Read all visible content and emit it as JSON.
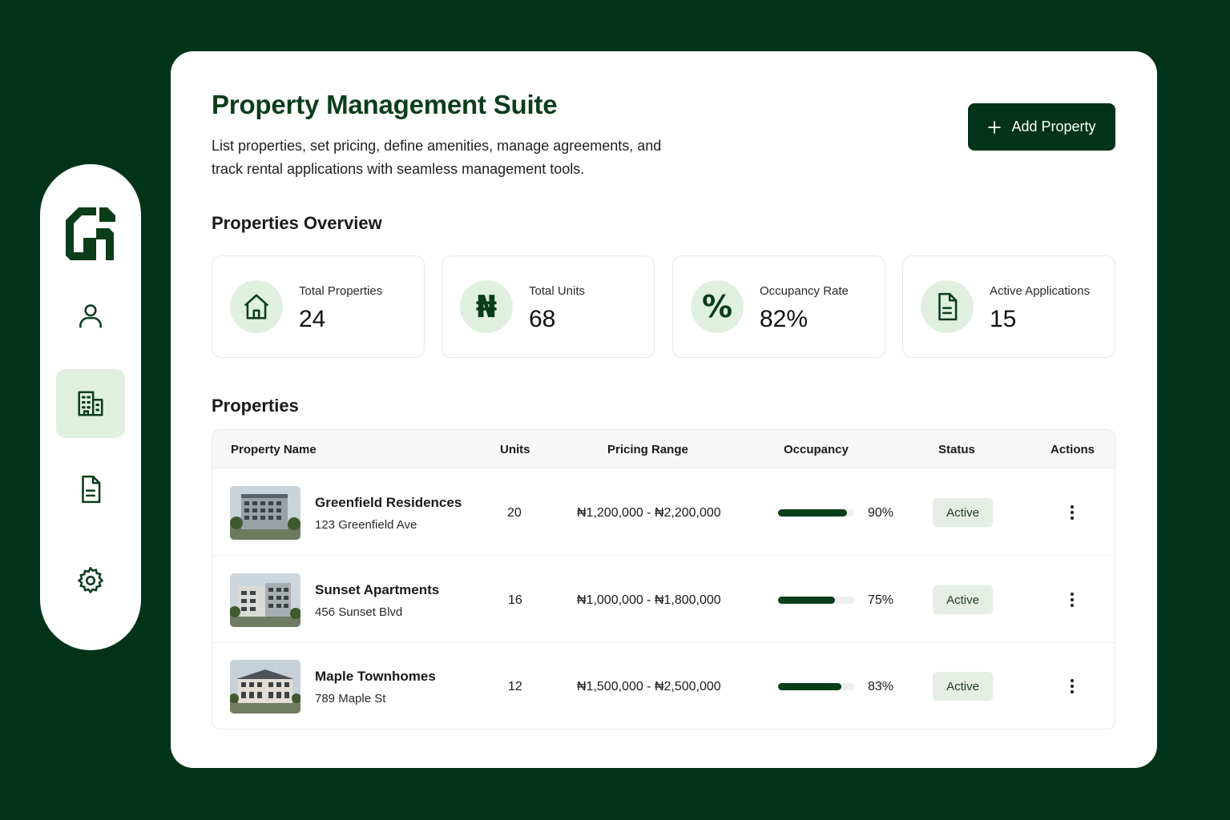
{
  "header": {
    "title": "Property Management Suite",
    "description": "List properties, set pricing, define amenities, manage agreements, and track rental applications with seamless management tools.",
    "add_button_label": "Add Property"
  },
  "sidebar": {
    "items": [
      {
        "name": "user-icon",
        "active": false
      },
      {
        "name": "building-icon",
        "active": true
      },
      {
        "name": "document-icon",
        "active": false
      },
      {
        "name": "settings-icon",
        "active": false
      }
    ]
  },
  "overview": {
    "title": "Properties Overview",
    "stats": [
      {
        "label": "Total Properties",
        "value": "24",
        "icon": "house-icon"
      },
      {
        "label": "Total Units",
        "value": "68",
        "icon": "naira-icon",
        "glyph": "₦"
      },
      {
        "label": "Occupancy Rate",
        "value": "82%",
        "icon": "percent-icon",
        "glyph": "%"
      },
      {
        "label": "Active Applications",
        "value": "15",
        "icon": "document-icon"
      }
    ]
  },
  "properties": {
    "title": "Properties",
    "columns": [
      "Property Name",
      "Units",
      "Pricing Range",
      "Occupancy",
      "Status",
      "Actions"
    ],
    "rows": [
      {
        "name": "Greenfield Residences",
        "address": "123 Greenfield Ave",
        "units": "20",
        "pricing": "₦1,200,000 - ₦2,200,000",
        "occupancy": "90%",
        "occupancy_value": 90,
        "status": "Active"
      },
      {
        "name": "Sunset Apartments",
        "address": "456 Sunset Blvd",
        "units": "16",
        "pricing": "₦1,000,000 - ₦1,800,000",
        "occupancy": "75%",
        "occupancy_value": 75,
        "status": "Active"
      },
      {
        "name": "Maple Townhomes",
        "address": "789 Maple St",
        "units": "12",
        "pricing": "₦1,500,000 - ₦2,500,000",
        "occupancy": "83%",
        "occupancy_value": 83,
        "status": "Active"
      }
    ]
  },
  "colors": {
    "brand": "#00331a",
    "accent_light": "#dff0de",
    "badge_bg": "#e5eee4"
  }
}
